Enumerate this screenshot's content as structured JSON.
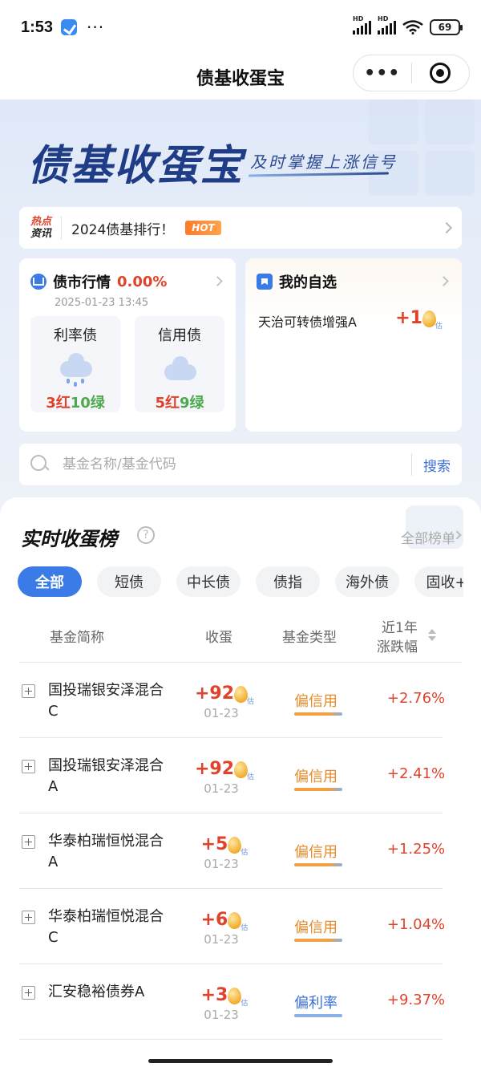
{
  "status_bar": {
    "time": "1:53",
    "dots": "···",
    "signal_labels": [
      "HD",
      "HD"
    ],
    "battery": "69"
  },
  "title_bar": {
    "title": "债基收蛋宝",
    "more": "•••"
  },
  "banner": {
    "logo": "债基收蛋宝",
    "slogan": "及时掌握上涨信号"
  },
  "hot_news": {
    "tag_line1": "热点",
    "tag_line2": "资讯",
    "text": "2024债基排行！",
    "badge": "HOT"
  },
  "market_card": {
    "title": "债市行情",
    "change": "0.00%",
    "date": "2025-01-23 13:45",
    "items": [
      {
        "name": "利率债",
        "weather_icon": "rain-cloud-icon",
        "red": "3红",
        "green": "10绿"
      },
      {
        "name": "信用债",
        "weather_icon": "cloud-icon",
        "red": "5红",
        "green": "9绿"
      }
    ]
  },
  "fav_card": {
    "title": "我的自选",
    "fund": "天治可转债增强A",
    "value": "+1",
    "egg_sub": "估"
  },
  "search": {
    "placeholder": "基金名称/基金代码",
    "button": "搜索"
  },
  "ranking": {
    "title": "实时收蛋榜",
    "help": "?",
    "all_link": "全部榜单",
    "tabs": [
      "全部",
      "短债",
      "中长债",
      "债指",
      "海外债",
      "固收+"
    ],
    "active_tab": 0,
    "columns": {
      "name": "基金简称",
      "eggs": "收蛋",
      "type": "基金类型",
      "change_line1": "近1年",
      "change_line2": "涨跌幅"
    },
    "rows": [
      {
        "name": "国投瑞银安泽混合C",
        "eggs": "+92",
        "egg_sub": "估",
        "date": "01-23",
        "type": "偏信用",
        "type_kind": "credit",
        "change": "+2.76%"
      },
      {
        "name": "国投瑞银安泽混合A",
        "eggs": "+92",
        "egg_sub": "估",
        "date": "01-23",
        "type": "偏信用",
        "type_kind": "credit",
        "change": "+2.41%"
      },
      {
        "name": "华泰柏瑞恒悦混合A",
        "eggs": "+5",
        "egg_sub": "估",
        "date": "01-23",
        "type": "偏信用",
        "type_kind": "credit",
        "change": "+1.25%"
      },
      {
        "name": "华泰柏瑞恒悦混合C",
        "eggs": "+6",
        "egg_sub": "估",
        "date": "01-23",
        "type": "偏信用",
        "type_kind": "credit",
        "change": "+1.04%"
      },
      {
        "name": "汇安稳裕债券A",
        "eggs": "+3",
        "egg_sub": "估",
        "date": "01-23",
        "type": "偏利率",
        "type_kind": "rate",
        "change": "+9.37%"
      }
    ]
  },
  "colors": {
    "accent": "#3a7be8",
    "red": "#e0432b",
    "green": "#4ea84e",
    "credit": "#e58b2a",
    "rate": "#3a6fd6"
  }
}
